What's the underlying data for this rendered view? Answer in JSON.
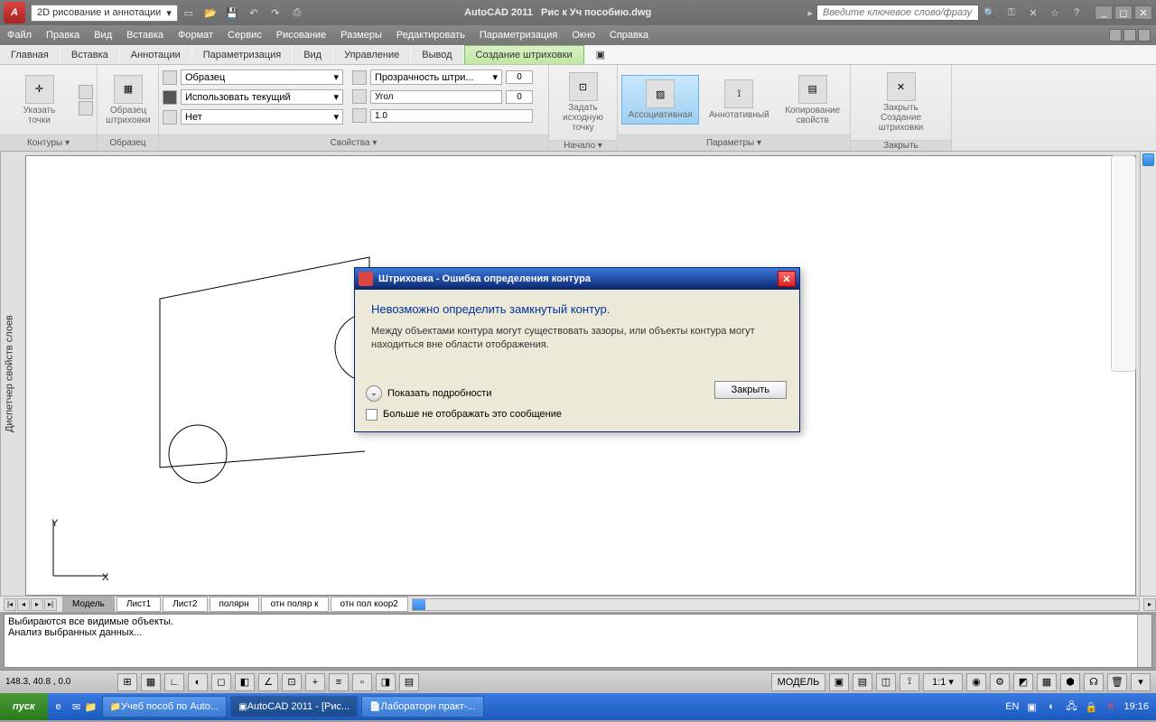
{
  "titlebar": {
    "workspace": "2D рисование и аннотации",
    "app": "AutoCAD 2011",
    "file": "Рис к Уч пособию.dwg",
    "search_placeholder": "Введите ключевое слово/фразу"
  },
  "menubar": [
    "Файл",
    "Правка",
    "Вид",
    "Вставка",
    "Формат",
    "Сервис",
    "Рисование",
    "Размеры",
    "Редактировать",
    "Параметризация",
    "Окно",
    "Справка"
  ],
  "ribbon_tabs": [
    "Главная",
    "Вставка",
    "Аннотации",
    "Параметризация",
    "Вид",
    "Управление",
    "Вывод",
    "Создание штриховки"
  ],
  "active_ribbon_tab": 7,
  "ribbon": {
    "panels": [
      {
        "label": "Контуры ▾",
        "buttons": [
          {
            "label": "Указать точки"
          },
          {
            "label": "□"
          }
        ]
      },
      {
        "label": "Образец",
        "buttons": [
          {
            "label": "Образец\nштриховки"
          }
        ]
      },
      {
        "label": "Свойства ▾",
        "props": {
          "row1_dd": "Образец",
          "row2_dd": "Использовать текущий",
          "row3_dd": "Нет",
          "trans_label": "Прозрачность штри...",
          "trans_val": "0",
          "angle_label": "Угол",
          "angle_val": "0",
          "scale_val": "1.0"
        }
      },
      {
        "label": "Начало ▾",
        "buttons": [
          {
            "label": "Задать\nисходную точку"
          }
        ]
      },
      {
        "label": "Параметры ▾",
        "buttons": [
          {
            "label": "Ассоциативная"
          },
          {
            "label": "Аннотативный"
          },
          {
            "label": "Копирование\nсвойств"
          }
        ]
      },
      {
        "label": "Закрыть",
        "buttons": [
          {
            "label": "Закрыть\nСоздание штриховки"
          }
        ]
      }
    ]
  },
  "left_rail": "Диспетчер свойств слоев",
  "layout_tabs": [
    "Модель",
    "Лист1",
    "Лист2",
    "полярн",
    "отн поляр к",
    "отн пол коор2"
  ],
  "active_layout": 0,
  "cmdline": [
    "Выбираются все видимые объекты.",
    "Анализ выбранных данных..."
  ],
  "statusbar": {
    "coords": "148.3, 40.8 , 0.0",
    "model": "МОДЕЛЬ",
    "scale": "1:1 ▾"
  },
  "taskbar": {
    "start": "пуск",
    "tasks": [
      "Учеб пособ по Auto...",
      "AutoCAD 2011 - [Рис...",
      "Лабораторн практ-..."
    ],
    "active_task": 1,
    "lang": "EN",
    "time": "19:16"
  },
  "dialog": {
    "title": "Штриховка - Ошибка определения контура",
    "heading": "Невозможно определить замкнутый контур.",
    "text": "Между объектами контура могут существовать зазоры, или объекты контура могут находиться вне области отображения.",
    "details": "Показать подробности",
    "dont_show": "Больше не отображать это сообщение",
    "close": "Закрыть"
  }
}
